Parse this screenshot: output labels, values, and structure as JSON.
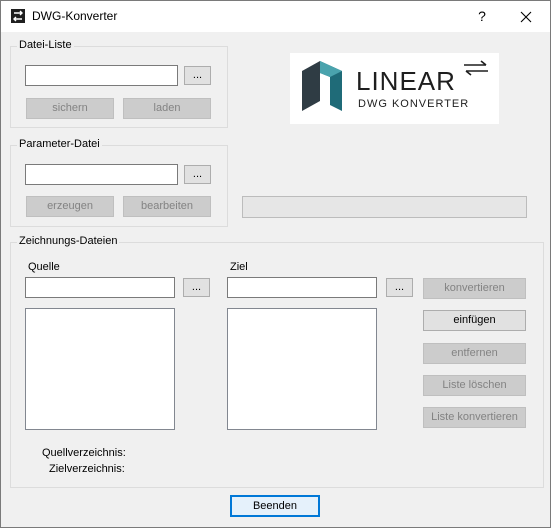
{
  "window": {
    "title": "DWG-Konverter",
    "help": "?",
    "close": "✕",
    "icon": "swap-arrows-icon"
  },
  "datei_liste": {
    "label": "Datei-Liste",
    "browse": "...",
    "save": "sichern",
    "load": "laden"
  },
  "parameter_datei": {
    "label": "Parameter-Datei",
    "browse": "...",
    "create": "erzeugen",
    "edit": "bearbeiten"
  },
  "logo": {
    "name": "LINEAR",
    "subtitle": "DWG KONVERTER"
  },
  "zeichnungs_dateien": {
    "label": "Zeichnungs-Dateien",
    "quelle_label": "Quelle",
    "ziel_label": "Ziel",
    "browse": "...",
    "convert": "konvertieren",
    "insert": "einfügen",
    "remove": "entfernen",
    "clear_list": "Liste löschen",
    "convert_list": "Liste konvertieren",
    "quellverzeichnis": "Quellverzeichnis:",
    "zielverzeichnis": "Zielverzeichnis:"
  },
  "footer": {
    "exit": "Beenden"
  }
}
